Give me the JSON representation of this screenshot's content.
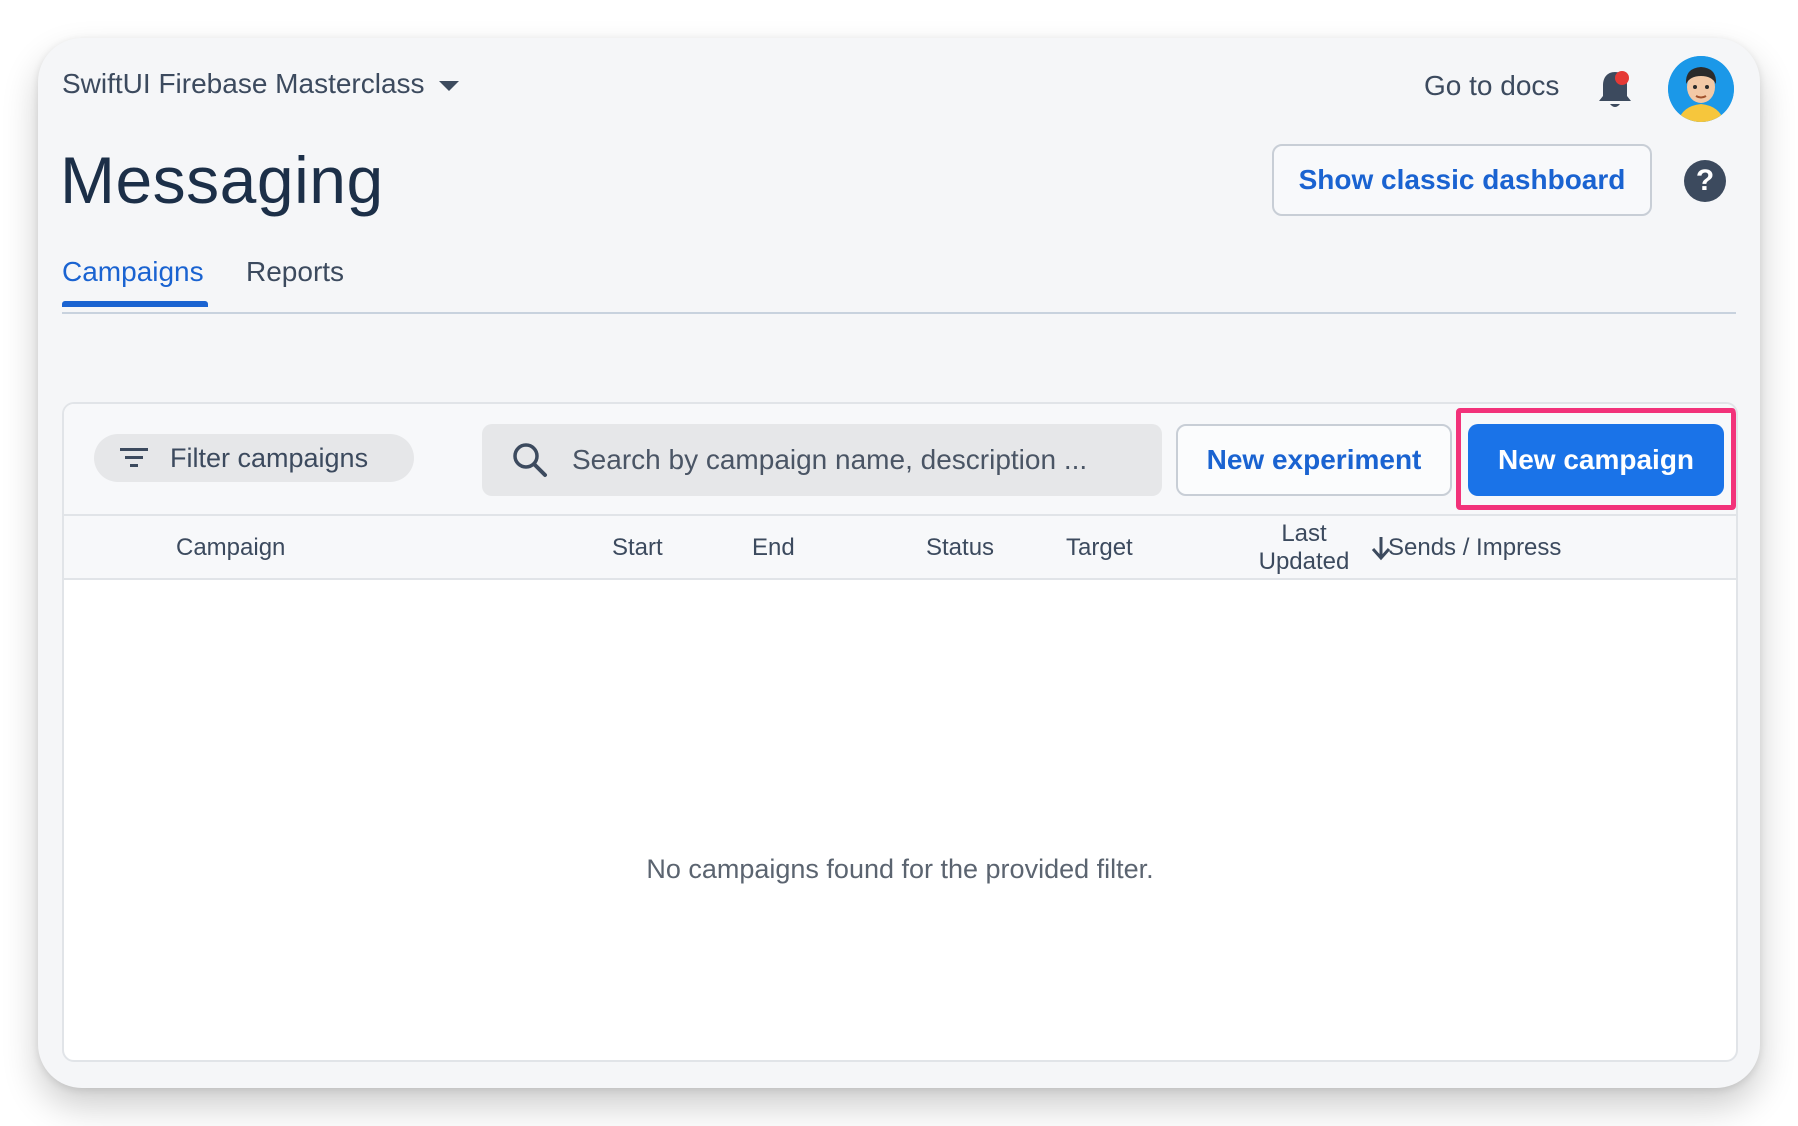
{
  "header": {
    "project_name": "SwiftUI Firebase Masterclass",
    "docs_link": "Go to docs"
  },
  "page": {
    "title": "Messaging",
    "classic_button": "Show classic dashboard",
    "help_label": "?"
  },
  "tabs": [
    {
      "label": "Campaigns",
      "active": true
    },
    {
      "label": "Reports",
      "active": false
    }
  ],
  "toolbar": {
    "filter_label": "Filter campaigns",
    "search_placeholder": "Search by campaign name, description ...",
    "experiment_button": "New experiment",
    "campaign_button": "New campaign"
  },
  "table": {
    "columns": {
      "campaign": "Campaign",
      "start": "Start",
      "end": "End",
      "status": "Status",
      "target": "Target",
      "last_updated_line1": "Last",
      "last_updated_line2": "Updated",
      "sends": "Sends / Impress"
    },
    "empty_message": "No campaigns found for the provided filter."
  },
  "colors": {
    "accent": "#1a73e8",
    "link_blue": "#1a63d1",
    "highlight": "#f2327a",
    "notification_dot": "#e53935"
  },
  "icons": [
    "chevron-down-icon",
    "bell-icon",
    "avatar",
    "help-icon",
    "filter-icon",
    "search-icon",
    "arrow-down-icon"
  ]
}
